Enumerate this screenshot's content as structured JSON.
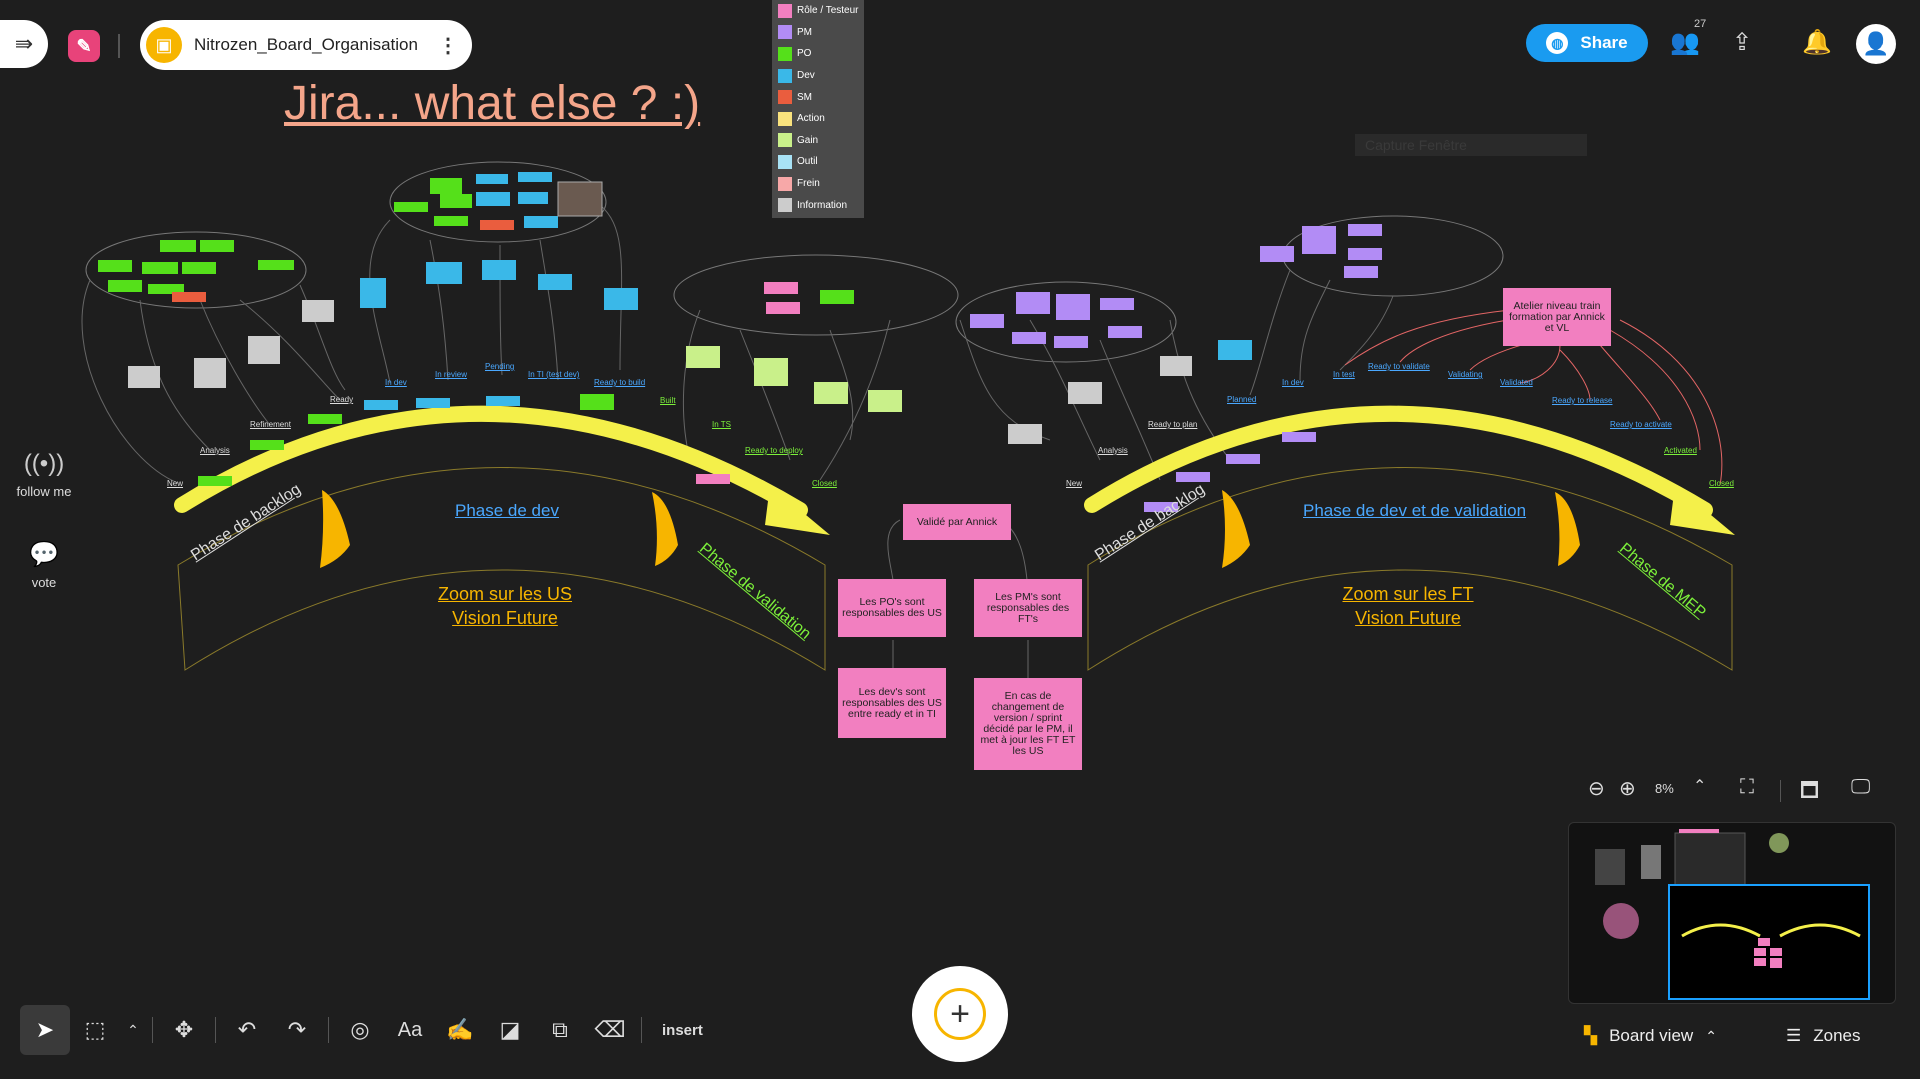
{
  "board": {
    "title": "Nitrozen_Board_Organisation"
  },
  "legend": [
    {
      "label": "Rôle / Testeur",
      "color": "#f27fc0"
    },
    {
      "label": "PM",
      "color": "#b28cf5"
    },
    {
      "label": "PO",
      "color": "#55e01a"
    },
    {
      "label": "Dev",
      "color": "#3ab8e8"
    },
    {
      "label": "SM",
      "color": "#ea5d3e"
    },
    {
      "label": "Action",
      "color": "#f9e27d"
    },
    {
      "label": "Gain",
      "color": "#c9f08a"
    },
    {
      "label": "Outil",
      "color": "#a8e2f5"
    },
    {
      "label": "Frein",
      "color": "#f7a8a8"
    },
    {
      "label": "Information",
      "color": "#cccccc"
    }
  ],
  "header": {
    "share_label": "Share",
    "collaborators_count": "27"
  },
  "canvas": {
    "title": "Jira... what else ? :)",
    "capture_label": "Capture Fenêtre",
    "left_flow": {
      "labels": [
        {
          "text": "New",
          "cls": "white"
        },
        {
          "text": "Analysis",
          "cls": "white"
        },
        {
          "text": "Refinement",
          "cls": "white"
        },
        {
          "text": "Ready",
          "cls": "white"
        },
        {
          "text": "In dev",
          "cls": "blue"
        },
        {
          "text": "In review",
          "cls": "blue"
        },
        {
          "text": "Pending",
          "cls": "blue"
        },
        {
          "text": "In TI (test dev)",
          "cls": "blue"
        },
        {
          "text": "Ready to build",
          "cls": "blue"
        },
        {
          "text": "Built",
          "cls": "green"
        },
        {
          "text": "In TS",
          "cls": "green"
        },
        {
          "text": "Ready to deploy",
          "cls": "green"
        },
        {
          "text": "Closed",
          "cls": "green"
        }
      ],
      "phase_backlog": "Phase de backlog",
      "phase_dev": "Phase de dev",
      "phase_validation": "Phase de validation",
      "zoom_line1": "Zoom sur les US",
      "zoom_line2": "Vision Future"
    },
    "right_flow": {
      "labels": [
        {
          "text": "New",
          "cls": "white"
        },
        {
          "text": "Analysis",
          "cls": "white"
        },
        {
          "text": "Ready to plan",
          "cls": "white"
        },
        {
          "text": "Planned",
          "cls": "blue"
        },
        {
          "text": "In dev",
          "cls": "blue"
        },
        {
          "text": "In test",
          "cls": "blue"
        },
        {
          "text": "Ready to validate",
          "cls": "blue"
        },
        {
          "text": "Validating",
          "cls": "blue"
        },
        {
          "text": "Validated",
          "cls": "blue"
        },
        {
          "text": "Ready to release",
          "cls": "blue"
        },
        {
          "text": "Ready to activate",
          "cls": "blue"
        },
        {
          "text": "Activated",
          "cls": "green"
        },
        {
          "text": "Closed",
          "cls": "green"
        }
      ],
      "phase_backlog": "Phase de backlog",
      "phase_dev": "Phase de dev et de validation",
      "phase_mep": "Phase de MEP",
      "zoom_line1": "Zoom sur les FT",
      "zoom_line2": "Vision Future"
    },
    "cards": {
      "valide": "Validé par Annick",
      "pos": "Les PO's sont responsables des US",
      "pms": "Les PM's sont responsables des FT's",
      "devs": "Les dev's sont responsables des US entre ready et in TI",
      "changement": "En cas de changement de version / sprint décidé par le PM, il met à jour les FT ET les US",
      "atelier": "Atelier niveau train formation par Annick et VL"
    }
  },
  "side": {
    "follow_label": "follow me",
    "vote_label": "vote"
  },
  "zoom": {
    "level": "8%"
  },
  "bottom": {
    "board_view_label": "Board view",
    "zones_label": "Zones",
    "insert_label": "insert"
  }
}
